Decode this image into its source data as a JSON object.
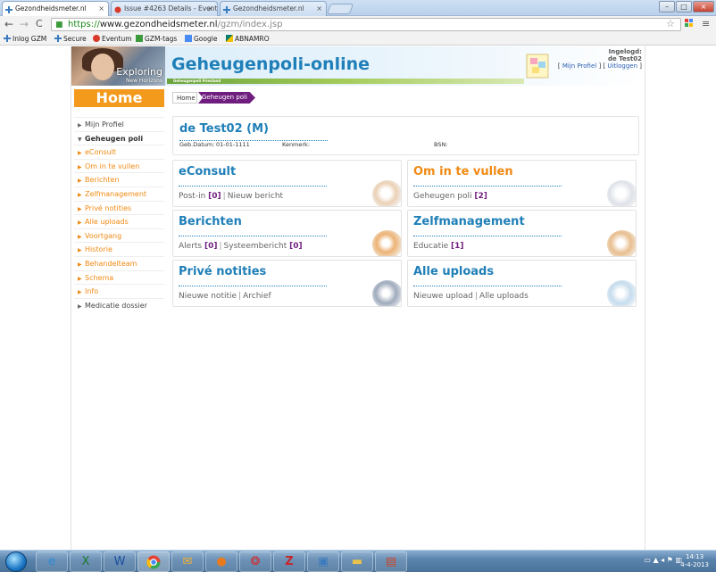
{
  "browser": {
    "tabs": [
      {
        "label": "Gezondheidsmeter.nl",
        "active": true
      },
      {
        "label": "Issue #4263 Details - Event",
        "active": false
      },
      {
        "label": "Gezondheidsmeter.nl",
        "active": false
      }
    ],
    "url": {
      "scheme": "https://",
      "host": "www.gezondheidsmeter.nl",
      "path": "/gzm/index.jsp"
    },
    "bookmarks": [
      "Inlog GZM",
      "Secure",
      "Eventum",
      "GZM-tags",
      "Google",
      "ABNAMRO"
    ]
  },
  "header": {
    "photo_text_1": "Exploring",
    "photo_text_2": "New Horizons",
    "title": "Geheugenpoli-online",
    "subtitle": "Geheugenpoli Friesland",
    "user_label": "Ingelogd:",
    "user_name": "de Test02",
    "profile_link": "Mijn Profiel",
    "logout_link": "Uitloggen"
  },
  "home_heading": "Home",
  "breadcrumb": [
    "Home",
    "Geheugen poli"
  ],
  "sidebar": {
    "items": [
      {
        "label": "Mijn Profiel",
        "style": "top"
      },
      {
        "label": "Geheugen poli",
        "style": "bold"
      },
      {
        "label": "eConsult",
        "style": "sub"
      },
      {
        "label": "Om in te vullen",
        "style": "sub"
      },
      {
        "label": "Berichten",
        "style": "sub"
      },
      {
        "label": "Zelfmanagement",
        "style": "sub"
      },
      {
        "label": "Privé notities",
        "style": "sub"
      },
      {
        "label": "Alle uploads",
        "style": "sub"
      },
      {
        "label": "Voortgang",
        "style": "sub"
      },
      {
        "label": "Historie",
        "style": "sub"
      },
      {
        "label": "Behandelteam",
        "style": "sub"
      },
      {
        "label": "Schema",
        "style": "sub"
      },
      {
        "label": "Info",
        "style": "sub"
      },
      {
        "label": "Medicatie dossier",
        "style": "top"
      }
    ]
  },
  "patient": {
    "name": "de Test02 (M)",
    "dob_label": "Geb.Datum:",
    "dob_value": "01-01-1111",
    "kenmerk_label": "Kenmerk:",
    "bsn_label": "BSN:"
  },
  "cards": {
    "econsult": {
      "title": "eConsult",
      "link1": "Post-in",
      "count1": "[0]",
      "link2": "Nieuw bericht"
    },
    "omintevullen": {
      "title": "Om in te vullen",
      "link1": "Geheugen poli",
      "count1": "[2]"
    },
    "berichten": {
      "title": "Berichten",
      "link1": "Alerts",
      "count1": "[0]",
      "link2": "Systeembericht",
      "count2": "[0]"
    },
    "zelfmanagement": {
      "title": "Zelfmanagement",
      "link1": "Educatie",
      "count1": "[1]"
    },
    "prive": {
      "title": "Privé notities",
      "link1": "Nieuwe notitie",
      "link2": "Archief"
    },
    "uploads": {
      "title": "Alle uploads",
      "link1": "Nieuwe upload",
      "link2": "Alle uploads"
    }
  },
  "taskbar": {
    "time": "14:13",
    "date": "4-4-2013"
  },
  "colors": {
    "title_blue": "#1f7fb8",
    "accent_orange": "#f08a14",
    "count_purple": "#6f1d7e",
    "home_orange": "#f39a1c"
  }
}
